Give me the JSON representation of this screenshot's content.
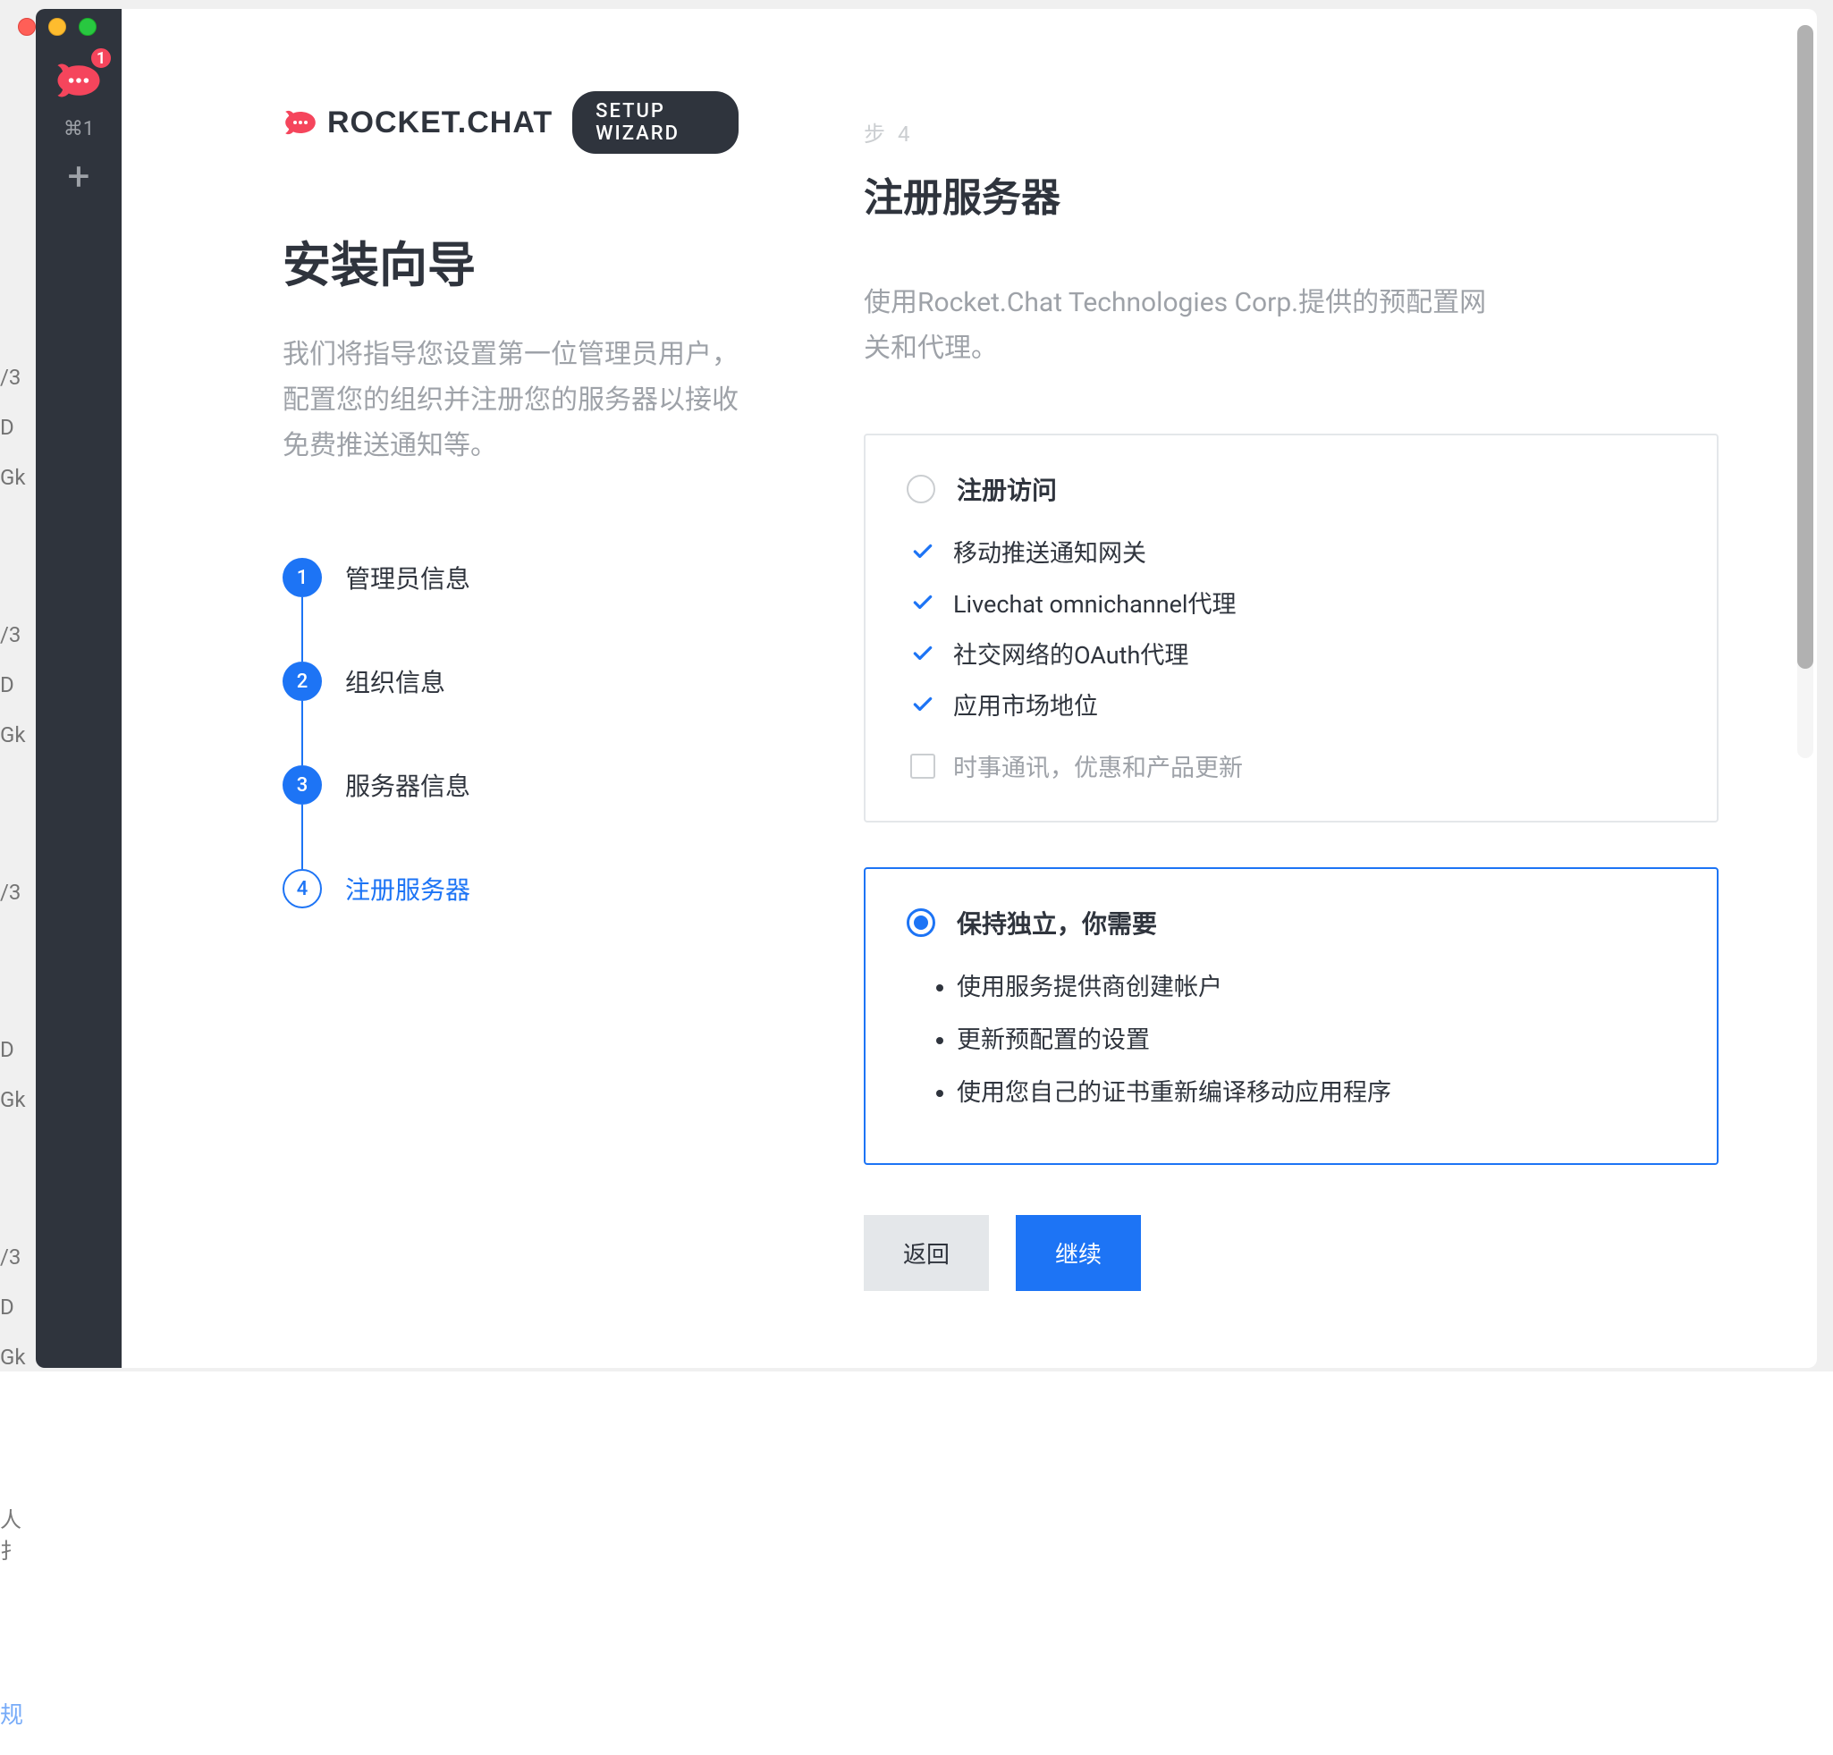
{
  "sidebar": {
    "notif_count": "1",
    "kbd_hint": "⌘1",
    "add_icon_label": "+"
  },
  "bg_hints": {
    "a": "/3",
    "b": "D",
    "c": "Gk",
    "d": "/3",
    "e": "D",
    "f": "Gk",
    "g": "/3",
    "h": "D",
    "i": "Gk",
    "j": "/3",
    "k": "D",
    "l": "Gk",
    "m": "人扌",
    "n": "规"
  },
  "brand": {
    "text": "ROCKET.CHAT",
    "badge": "SETUP WIZARD"
  },
  "wizard": {
    "title": "安装向导",
    "description": "我们将指导您设置第一位管理员用户，配置您的组织并注册您的服务器以接收免费推送通知等。",
    "steps": [
      {
        "num": "1",
        "label": "管理员信息",
        "state": "done"
      },
      {
        "num": "2",
        "label": "组织信息",
        "state": "done"
      },
      {
        "num": "3",
        "label": "服务器信息",
        "state": "done"
      },
      {
        "num": "4",
        "label": "注册服务器",
        "state": "current"
      }
    ]
  },
  "panel": {
    "step_prefix": "步",
    "step_number": "4",
    "title": "注册服务器",
    "description": "使用Rocket.Chat Technologies Corp.提供的预配置网关和代理。"
  },
  "option_register": {
    "title": "注册访问",
    "features": [
      "移动推送通知网关",
      "Livechat omnichannel代理",
      "社交网络的OAuth代理",
      "应用市场地位"
    ],
    "newsletter": "时事通讯，优惠和产品更新"
  },
  "option_standalone": {
    "title": "保持独立，你需要",
    "bullets": [
      "使用服务提供商创建帐户",
      "更新预配置的设置",
      "使用您自己的证书重新编译移动应用程序"
    ]
  },
  "buttons": {
    "back": "返回",
    "continue": "继续"
  }
}
